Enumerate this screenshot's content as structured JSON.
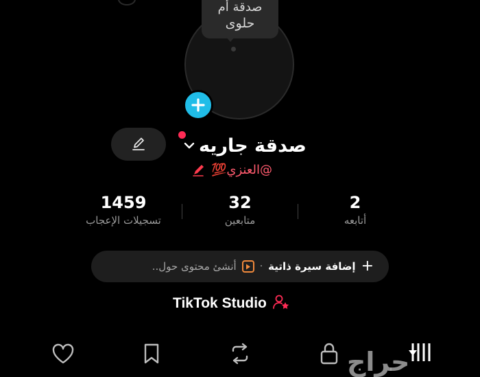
{
  "note": {
    "line1": "صدقة أم",
    "line2": "حلوى"
  },
  "profile": {
    "display_name": "صدقة جاريه",
    "username": "@العنزي💯"
  },
  "stats": {
    "likes": {
      "value": "1459",
      "label": "تسجيلات الإعجاب"
    },
    "followers": {
      "value": "32",
      "label": "متابعين"
    },
    "following": {
      "value": "2",
      "label": "أتابعه"
    }
  },
  "bio": {
    "add_label": "إضافة سيرة ذاتية",
    "separator": "·",
    "hint": "أنشئ محتوى حول.."
  },
  "studio": {
    "label": "TikTok Studio"
  },
  "watermark": {
    "text": "حراج"
  },
  "colors": {
    "accent_blue": "#20bde8",
    "accent_red": "#ff2b55",
    "username_red": "#ff5b6e",
    "play_orange": "#f28a3c"
  },
  "icons": {
    "avatar_add": "plus-icon",
    "edit": "pencil-icon",
    "name_menu": "chevron-down-icon",
    "username_decor": "pencil-icon",
    "bio_play": "play-icon",
    "studio": "person-star-icon",
    "tabs": [
      "heart-icon",
      "bookmark-icon",
      "repost-icon",
      "lock-icon",
      "grid-icon"
    ]
  }
}
